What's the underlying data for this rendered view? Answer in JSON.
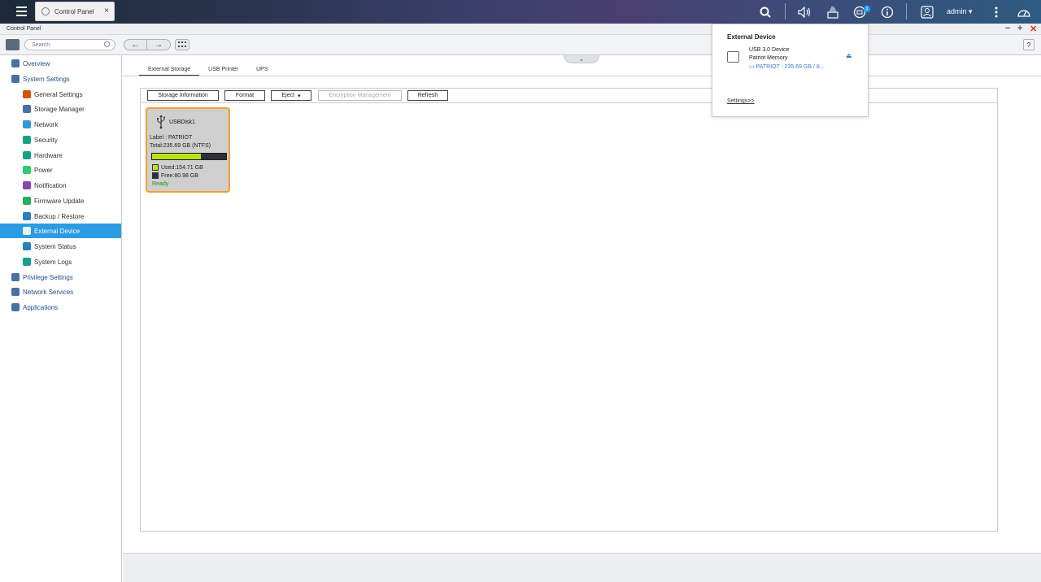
{
  "taskbar": {
    "app_tab_title": "Control Panel",
    "app_tab_close": "×",
    "user": "admin",
    "notification_count": "1"
  },
  "window": {
    "title": "Control Panel",
    "minimize": "−",
    "maximize": "+",
    "close": "✕"
  },
  "toolbar": {
    "search_placeholder": "Search",
    "back": "←",
    "forward": "→",
    "help": "?"
  },
  "sidebar": {
    "items": [
      {
        "label": "Overview",
        "level": "top",
        "icon": "overview-icon",
        "color": "#4a6fa5"
      },
      {
        "label": "System Settings",
        "level": "top",
        "icon": "gear-icon",
        "color": "#4a6fa5"
      },
      {
        "label": "General Settings",
        "level": "sub",
        "icon": "general-settings-icon",
        "color": "#d35400"
      },
      {
        "label": "Storage Manager",
        "level": "sub",
        "icon": "storage-icon",
        "color": "#4a6fa5"
      },
      {
        "label": "Network",
        "level": "sub",
        "icon": "network-icon",
        "color": "#3498db"
      },
      {
        "label": "Security",
        "level": "sub",
        "icon": "security-icon",
        "color": "#16a085"
      },
      {
        "label": "Hardware",
        "level": "sub",
        "icon": "hardware-icon",
        "color": "#16a085"
      },
      {
        "label": "Power",
        "level": "sub",
        "icon": "power-icon",
        "color": "#2ecc71"
      },
      {
        "label": "Notification",
        "level": "sub",
        "icon": "notification-icon",
        "color": "#8e44ad"
      },
      {
        "label": "Firmware Update",
        "level": "sub",
        "icon": "firmware-icon",
        "color": "#27ae60"
      },
      {
        "label": "Backup / Restore",
        "level": "sub",
        "icon": "backup-icon",
        "color": "#2980b9"
      },
      {
        "label": "External Device",
        "level": "sub",
        "icon": "external-device-icon",
        "color": "#ffffff",
        "active": true
      },
      {
        "label": "System Status",
        "level": "sub",
        "icon": "system-status-icon",
        "color": "#2980b9"
      },
      {
        "label": "System Logs",
        "level": "sub",
        "icon": "system-logs-icon",
        "color": "#16a085"
      },
      {
        "label": "Privilege Settings",
        "level": "top",
        "icon": "privilege-icon",
        "color": "#4a6fa5"
      },
      {
        "label": "Network Services",
        "level": "top",
        "icon": "network-services-icon",
        "color": "#4a6fa5"
      },
      {
        "label": "Applications",
        "level": "top",
        "icon": "applications-icon",
        "color": "#4a6fa5"
      }
    ]
  },
  "tabs": [
    "External Storage",
    "USB Printer",
    "UPS"
  ],
  "buttons": {
    "storage_info": "Storage Information",
    "format": "Format",
    "eject": "Eject",
    "encryption": "Encryption Management",
    "refresh": "Refresh"
  },
  "disk": {
    "name": "USBDisk1",
    "label": "Label : PATRIOT",
    "total": "Total:235.69 GB (NTFS)",
    "used_fraction": 0.656,
    "used": "Used:154.71 GB",
    "free": "Free:80.98 GB",
    "status": "Ready",
    "used_color": "#b8e21a",
    "free_color": "#2b2f36"
  },
  "popup": {
    "title": "External Device",
    "device_type": "USB 3.0 Device",
    "device_name": "Patriot Memory",
    "volume": "PATRIOT : 235.69 GB / 8...",
    "settings_link": "Settings>>"
  }
}
